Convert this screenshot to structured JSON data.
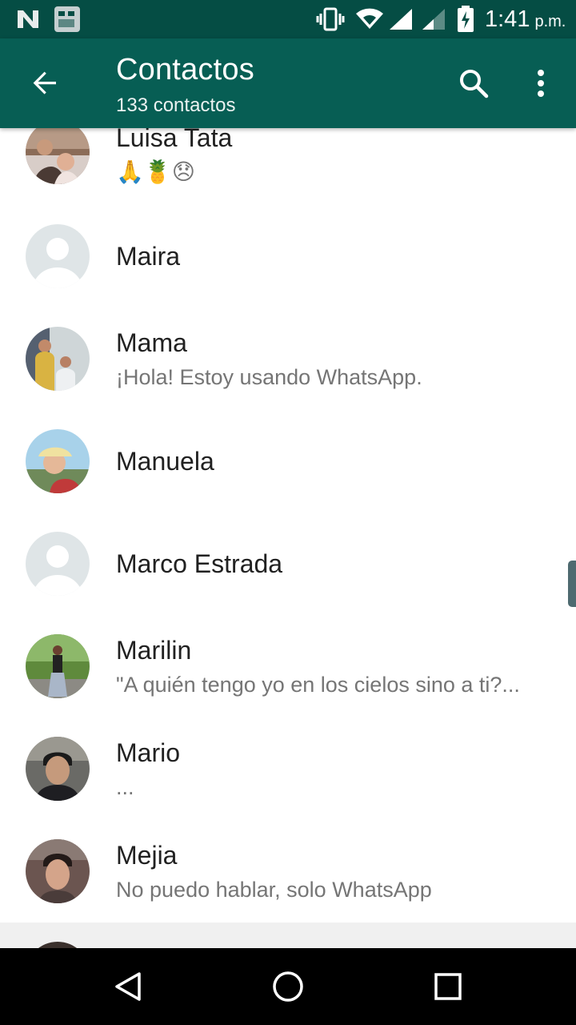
{
  "status_bar": {
    "time": "1:41",
    "ampm": "p.m."
  },
  "toolbar": {
    "title": "Contactos",
    "subtitle": "133 contactos",
    "back_icon": "arrow-back-icon",
    "search_icon": "search-icon",
    "menu_icon": "more-vert-icon"
  },
  "contacts": [
    {
      "name": "Luisa Tata",
      "status": "🙏🍍😞",
      "avatar": "photo"
    },
    {
      "name": "Maira",
      "status": "",
      "avatar": "placeholder"
    },
    {
      "name": "Mama",
      "status": "¡Hola! Estoy usando WhatsApp.",
      "avatar": "photo"
    },
    {
      "name": "Manuela",
      "status": "",
      "avatar": "photo"
    },
    {
      "name": "Marco Estrada",
      "status": "",
      "avatar": "placeholder"
    },
    {
      "name": "Marilin",
      "status": "\"A quién tengo yo en los cielos sino a ti?...",
      "avatar": "photo"
    },
    {
      "name": "Mario",
      "status": "...",
      "avatar": "photo"
    },
    {
      "name": "Mejia",
      "status": "No puedo hablar, solo WhatsApp",
      "avatar": "photo"
    }
  ],
  "colors": {
    "toolbar": "#075e54",
    "status_bar": "#054d44"
  },
  "nav": {
    "back": "nav-back-icon",
    "home": "nav-home-icon",
    "recents": "nav-recents-icon"
  }
}
